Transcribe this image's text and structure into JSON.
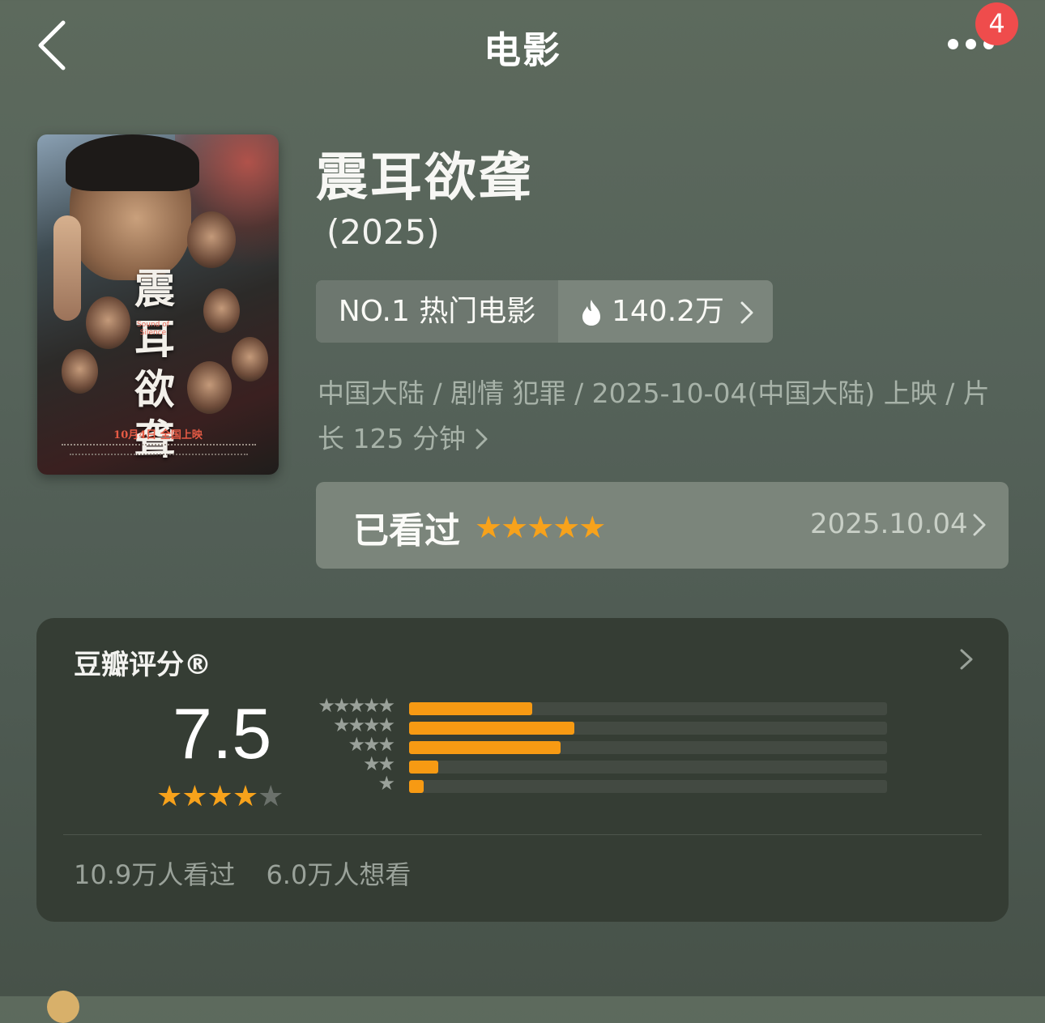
{
  "nav": {
    "title": "电影",
    "notification_count": "4"
  },
  "movie": {
    "title": "震耳欲聋",
    "year": "(2025)",
    "poster": {
      "title_text": "震耳欲聋",
      "subtitle_text": "Sound of Silence",
      "release_text": "10月4日 全国上映"
    },
    "rank_label": "NO.1 热门电影",
    "heat": "140.2万",
    "meta_line": "中国大陆 / 剧情 犯罪 / 2025-10-04(中国大陆) 上映 / 片长 125 分钟"
  },
  "watched": {
    "label": "已看过",
    "stars": "★★★★★",
    "date": "2025.10.04"
  },
  "rating": {
    "title": "豆瓣评分®",
    "score": "7.5",
    "stars_on": "★★★★",
    "stars_off": "★",
    "distribution": [
      {
        "level": "★★★★★",
        "fraction": 0.257
      },
      {
        "level": "★★★★",
        "fraction": 0.346
      },
      {
        "level": "★★★",
        "fraction": 0.317
      },
      {
        "level": "★★",
        "fraction": 0.061
      },
      {
        "level": "★",
        "fraction": 0.031
      }
    ],
    "seen": "10.9万人看过",
    "want": "6.0万人想看"
  },
  "colors": {
    "accent_star": "#f7a21b",
    "bar_fill": "#f79a13",
    "badge": "#ef4c4c"
  }
}
